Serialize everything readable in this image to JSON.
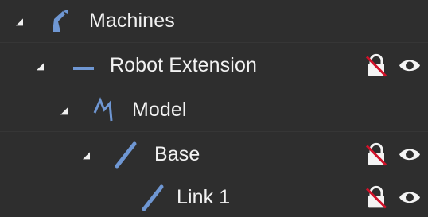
{
  "tree": {
    "items": [
      {
        "label": "Machines",
        "icon": "robot-arm-icon",
        "expanded": true,
        "locked": false,
        "visible": true
      },
      {
        "label": "Robot Extension",
        "icon": "extension-line-icon",
        "expanded": true,
        "locked": true,
        "visible": true
      },
      {
        "label": "Model",
        "icon": "model-zigzag-icon",
        "expanded": true,
        "locked": false,
        "visible": true
      },
      {
        "label": "Base",
        "icon": "link-segment-icon",
        "expanded": true,
        "locked": true,
        "visible": true
      },
      {
        "label": "Link 1",
        "icon": "link-segment-icon",
        "expanded": false,
        "locked": true,
        "visible": true
      }
    ]
  },
  "colors": {
    "background": "#2e2e2e",
    "text": "#f2f2f2",
    "icon_blue": "#6f97d3",
    "lock_white": "#f4f4f4",
    "lock_strike": "#d0122a",
    "eye_white": "#f4f4f4"
  }
}
